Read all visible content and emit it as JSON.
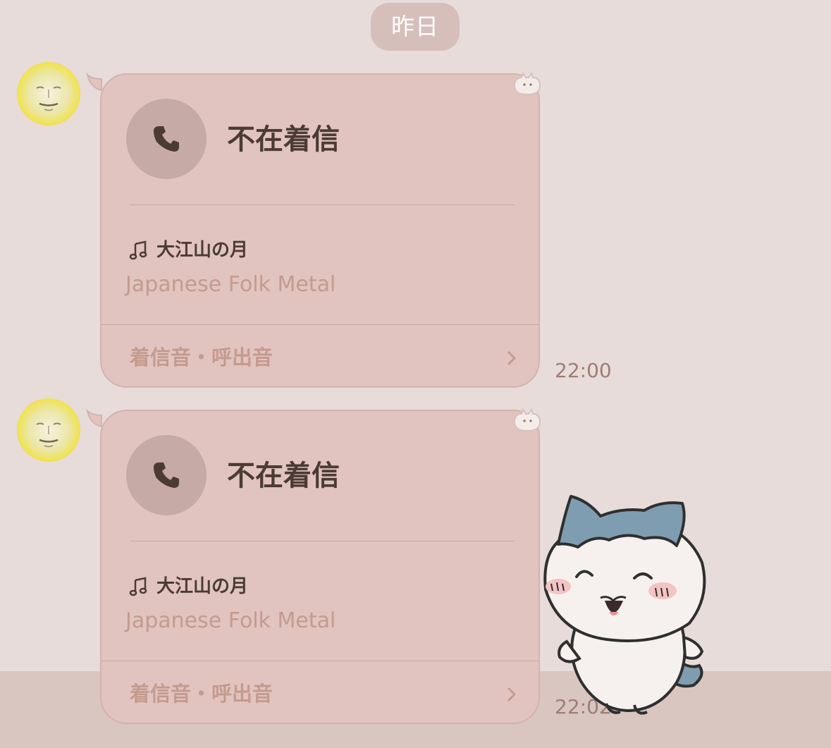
{
  "date_separator": "昨日",
  "messages": [
    {
      "call_status": "不在着信",
      "song_title": "大江山の月",
      "song_genre": "Japanese Folk Metal",
      "ringtone_link": "着信音・呼出音",
      "time": "22:00"
    },
    {
      "call_status": "不在着信",
      "song_title": "大江山の月",
      "song_genre": "Japanese Folk Metal",
      "ringtone_link": "着信音・呼出音",
      "time": "22:02"
    }
  ],
  "icons": {
    "phone": "phone-icon",
    "music": "music-note-icon",
    "chevron": "chevron-right-icon"
  },
  "colors": {
    "background": "#e7dcd9",
    "bubble": "#e1c4bf",
    "bubble_border": "#d2b3ad",
    "call_circle": "#c6aaa5",
    "primary_text": "#4b3b35",
    "secondary_text": "#c59a8f",
    "timestamp": "#9e7d76"
  }
}
